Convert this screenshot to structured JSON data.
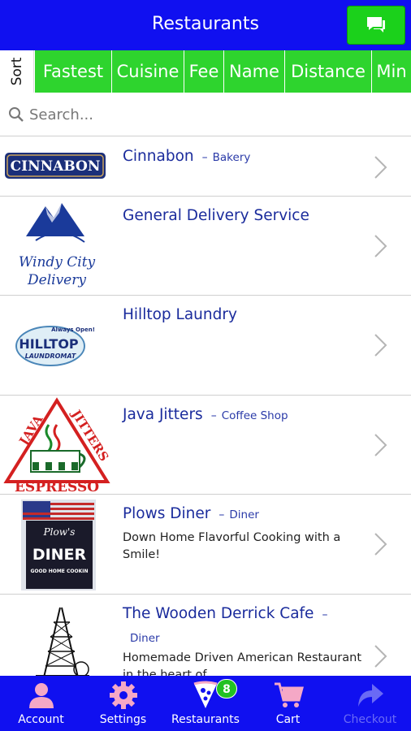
{
  "header": {
    "title": "Restaurants",
    "chat_icon": "chat-bubbles-icon"
  },
  "sort": {
    "label": "Sort",
    "options": [
      "Fastest",
      "Cuisine",
      "Fee",
      "Name",
      "Distance",
      "Min"
    ]
  },
  "search": {
    "placeholder": "Search..."
  },
  "restaurants": [
    {
      "name": "Cinnabon",
      "category": "Bakery",
      "description": "",
      "logo_text": "CINNABON"
    },
    {
      "name": "General Delivery Service",
      "category": "",
      "description": "",
      "logo_text": "Windy City Delivery"
    },
    {
      "name": "Hilltop Laundry",
      "category": "",
      "description": "",
      "logo_text": "HILLTOP",
      "logo_sub": "LAUNDROMAT",
      "logo_badge": "Always Open!"
    },
    {
      "name": "Java Jitters",
      "category": "Coffee Shop",
      "description": "",
      "logo_text": "JAVA JITTERS",
      "logo_sub": "ESPRESSO"
    },
    {
      "name": "Plows Diner",
      "category": "Diner",
      "description": "Down Home Flavorful Cooking with a Smile!",
      "logo_text": "Plow's DINER",
      "logo_sub": "GOOD HOME COOKIN"
    },
    {
      "name": "The Wooden Derrick Cafe",
      "category": "Diner",
      "description": "Homemade Driven American Restaurant in the heart of",
      "logo_text": ""
    }
  ],
  "tabs": [
    {
      "label": "Account",
      "icon": "person-icon"
    },
    {
      "label": "Settings",
      "icon": "gear-icon"
    },
    {
      "label": "Restaurants",
      "icon": "pizza-slice-icon",
      "badge": "8"
    },
    {
      "label": "Cart",
      "icon": "cart-icon"
    },
    {
      "label": "Checkout",
      "icon": "arrow-forward-icon"
    }
  ],
  "colors": {
    "header_blue": "#1010f0",
    "sort_green": "#2ed42e",
    "link_blue": "#1a2b9c",
    "tab_icon_pink": "#f5a8c6"
  }
}
